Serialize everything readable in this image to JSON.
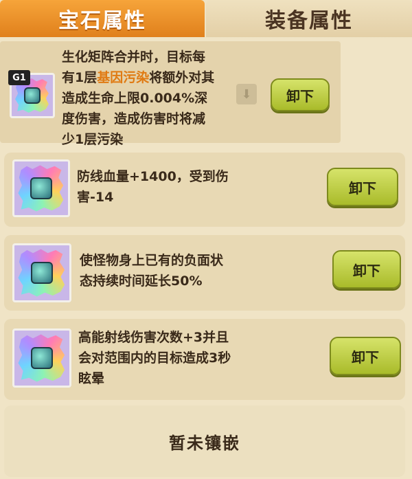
{
  "tabs": {
    "active": "宝石属性",
    "inactive": "装备属性"
  },
  "rows": [
    {
      "grade": "G1",
      "desc_parts": [
        "生化矩阵合并时，目标每",
        "有1层",
        "基因污染",
        "将额外对其",
        "造成生命上限0.004%深",
        "度伤害，造成伤害时将减",
        "少1层污染"
      ],
      "button": "卸下"
    },
    {
      "desc_lines": [
        "防线血量+1400，受到伤",
        "害-14"
      ],
      "button": "卸下"
    },
    {
      "desc_lines": [
        "使怪物身上已有的负面状",
        "态持续时间延长50%"
      ],
      "button": "卸下"
    },
    {
      "desc_lines": [
        "高能射线伤害次数+3并且",
        "会对范围内的目标造成3秒",
        "眩晕"
      ],
      "button": "卸下"
    }
  ],
  "empty_slot": "暂未镶嵌",
  "colors": {
    "tab_active": "#f0901f",
    "highlight": "#e07a12",
    "button": "#c4d24a"
  }
}
